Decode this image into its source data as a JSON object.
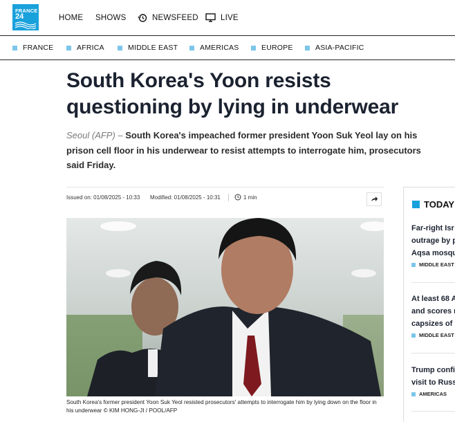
{
  "logo": {
    "line1": "FRANCE",
    "line2": "24"
  },
  "nav": {
    "home": "HOME",
    "shows": "SHOWS",
    "newsfeed": "NEWSFEED",
    "live": "LIVE"
  },
  "sections": [
    "FRANCE",
    "AFRICA",
    "MIDDLE EAST",
    "AMERICAS",
    "EUROPE",
    "ASIA-PACIFIC"
  ],
  "article": {
    "title_line1": "South Korea's Yoon resists",
    "title_line2": "questioning by lying in underwear",
    "dateline": "Seoul (AFP) – ",
    "lead": "South Korea's impeached former president Yoon Suk Yeol lay on his prison cell floor in his underwear to resist attempts to interrogate him, prosecutors said Friday.",
    "issued": "Issued on: 01/08/2025 - 10:33",
    "modified": "Modified: 01/08/2025 - 10:31",
    "read_time": "1 min",
    "caption": "South Korea's former president Yoon Suk Yeol resisted prosecutors' attempts to interrogate him by lying down on the floor in his underwear © KIM HONG-JI / POOL/AFP"
  },
  "sidebar": {
    "title": "TODAY",
    "items": [
      {
        "lines": [
          "Far-right Isr",
          "outrage by p",
          "Aqsa mosqu"
        ],
        "tag": "MIDDLE EAST"
      },
      {
        "lines": [
          "At least 68 A",
          "and scores m",
          "capsizes of"
        ],
        "tag": "MIDDLE EAST"
      },
      {
        "lines": [
          "Trump confi",
          "visit to Russ"
        ],
        "tag": "AMERICAS"
      }
    ]
  },
  "colors": {
    "brand": "#19a1dc",
    "section_marker": "#7cc6ea",
    "title": "#1b2230"
  },
  "icons": {
    "newsfeed": "clock-rewind-icon",
    "live": "monitor-icon",
    "share": "share-arrow-icon",
    "read_time": "clock-icon"
  }
}
